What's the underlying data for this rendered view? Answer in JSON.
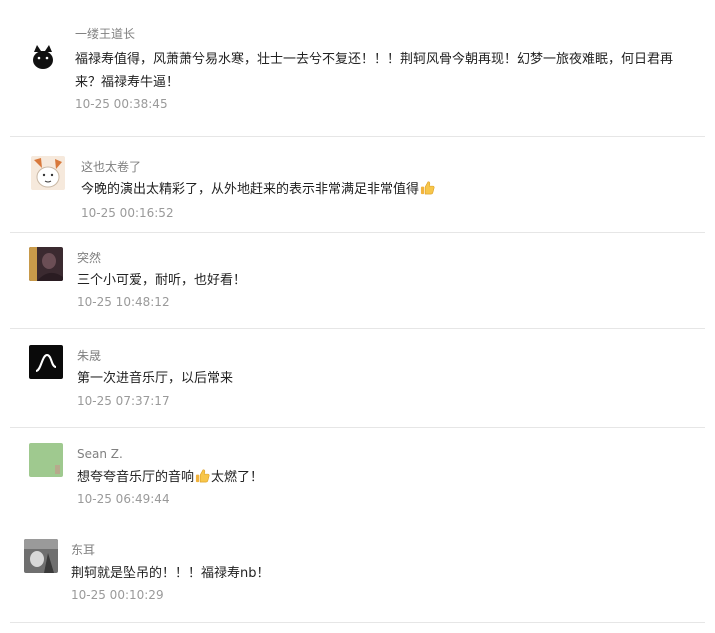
{
  "comments": [
    {
      "username": "一缕王道长",
      "content": "福禄寿值得，风萧萧兮易水寒，壮士一去兮不复还！！！荆轲风骨今朝再现！幻梦一旅夜难眠，何日君再来？福禄寿牛逼！",
      "time": "10-25 00:38:45",
      "avatar_icon": "black-cat-icon"
    },
    {
      "username": "这也太卷了",
      "content_before": "今晚的演出太精彩了，从外地赶来的表示非常满足非常值得",
      "content_after": "",
      "inline_icon": "thumbs-up-emoji",
      "time": "10-25 00:16:52",
      "avatar_icon": "cartoon-dog-icon"
    },
    {
      "username": "突然",
      "content": "三个小可爱，耐听，也好看！",
      "time": "10-25 10:48:12",
      "avatar_icon": "dark-portrait-icon"
    },
    {
      "username": "朱晟",
      "content": "第一次进音乐厅，以后常来",
      "time": "10-25 07:37:17",
      "avatar_icon": "black-squiggle-icon"
    },
    {
      "username": "Sean Z.",
      "content_before": "想夸夸音乐厅的音响",
      "content_after": "太燃了！",
      "inline_icon": "thumbs-up-emoji",
      "time": "10-25 06:49:44",
      "avatar_icon": "green-tile-icon"
    },
    {
      "username": "东耳",
      "content": "荆轲就是坠吊的！！！福禄寿nb！",
      "time": "10-25 00:10:29",
      "avatar_icon": "grey-photo-icon"
    }
  ],
  "colors": {
    "name": "#808080",
    "content": "#222222",
    "time": "#9a9a9a",
    "divider": "#e6e6e6",
    "green_avatar": "#9fc98f"
  }
}
